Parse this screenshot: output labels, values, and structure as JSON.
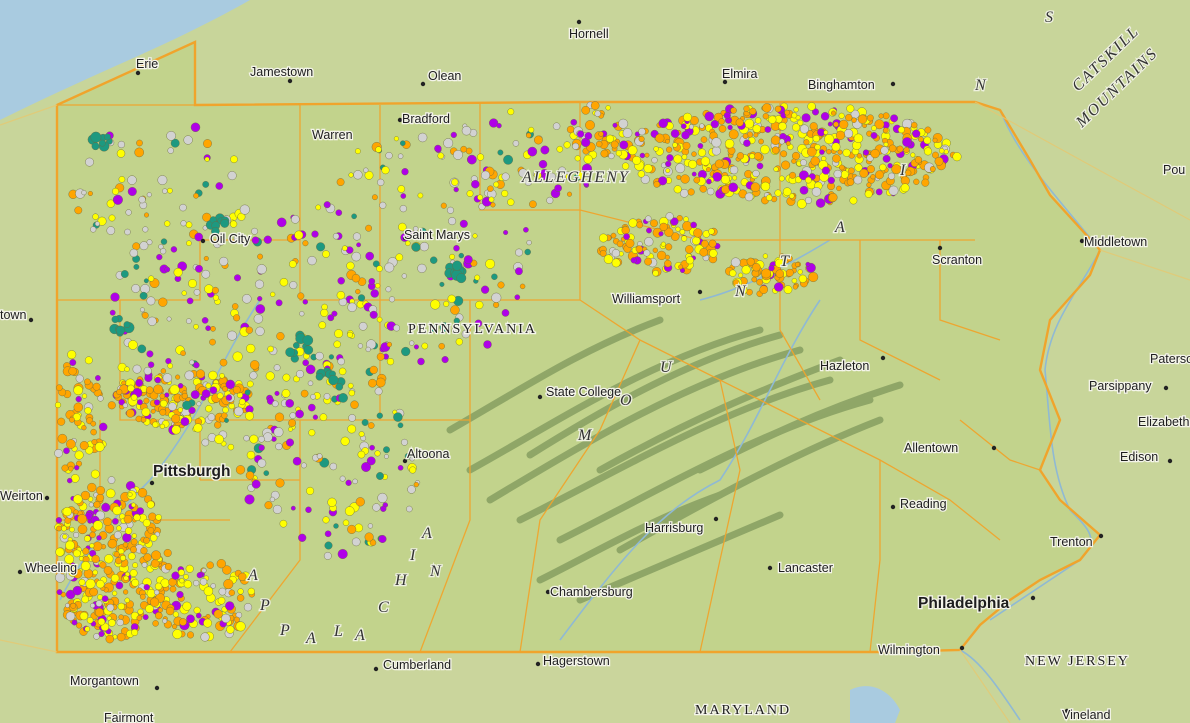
{
  "map": {
    "region": "Pennsylvania",
    "colors": {
      "water": "#a9cbe0",
      "land": "#c8d59a",
      "pa_fill": "#c2d38c",
      "boundary": "#f0a42c",
      "well_yellow": "#ffff00",
      "well_orange": "#ffa500",
      "well_purple": "#b000e8",
      "well_teal": "#1d9980",
      "well_gray": "#d2d2d2"
    },
    "places": [
      {
        "name": "Erie",
        "size": "normal"
      },
      {
        "name": "Jamestown",
        "size": "normal"
      },
      {
        "name": "Olean",
        "size": "normal"
      },
      {
        "name": "Hornell",
        "size": "normal"
      },
      {
        "name": "Elmira",
        "size": "normal"
      },
      {
        "name": "Binghamton",
        "size": "normal"
      },
      {
        "name": "Warren",
        "size": "normal"
      },
      {
        "name": "Bradford",
        "size": "normal"
      },
      {
        "name": "Oil City",
        "size": "normal"
      },
      {
        "name": "Saint Marys",
        "size": "normal"
      },
      {
        "name": "Middletown",
        "size": "normal"
      },
      {
        "name": "Scranton",
        "size": "normal"
      },
      {
        "name": "Williamsport",
        "size": "normal"
      },
      {
        "name": "town",
        "size": "normal"
      },
      {
        "name": "Hazleton",
        "size": "normal"
      },
      {
        "name": "Paterson",
        "size": "normal"
      },
      {
        "name": "Parsippany",
        "size": "normal"
      },
      {
        "name": "State College",
        "size": "normal"
      },
      {
        "name": "Elizabeth",
        "size": "normal"
      },
      {
        "name": "Allentown",
        "size": "normal"
      },
      {
        "name": "Edison",
        "size": "normal"
      },
      {
        "name": "Pittsburgh",
        "size": "large"
      },
      {
        "name": "Altoona",
        "size": "normal"
      },
      {
        "name": "Weirton",
        "size": "normal"
      },
      {
        "name": "Reading",
        "size": "normal"
      },
      {
        "name": "Harrisburg",
        "size": "normal"
      },
      {
        "name": "Trenton",
        "size": "normal"
      },
      {
        "name": "Wheeling",
        "size": "normal"
      },
      {
        "name": "Lancaster",
        "size": "normal"
      },
      {
        "name": "Chambersburg",
        "size": "normal"
      },
      {
        "name": "Philadelphia",
        "size": "large"
      },
      {
        "name": "Cumberland",
        "size": "normal"
      },
      {
        "name": "Hagerstown",
        "size": "normal"
      },
      {
        "name": "Wilmington",
        "size": "normal"
      },
      {
        "name": "Morgantown",
        "size": "normal"
      },
      {
        "name": "Vineland",
        "size": "normal"
      },
      {
        "name": "Fairmont",
        "size": "normal"
      },
      {
        "name": "Pou",
        "size": "normal"
      }
    ],
    "region_labels": {
      "pennsylvania": "PENNSYLVANIA",
      "new_jersey": "NEW JERSEY",
      "maryland": "MARYLAND",
      "allegheny": "ALLEGHENY",
      "appalachian_mountains": [
        "A",
        "P",
        "P",
        "A",
        "L",
        "A",
        "C",
        "H",
        "I",
        "A",
        "N",
        "M",
        "O",
        "U",
        "N",
        "T",
        "A",
        "I",
        "N",
        "S"
      ],
      "catskill": "CATSKILL",
      "catskill_mountains": "MOUNTAINS"
    }
  }
}
